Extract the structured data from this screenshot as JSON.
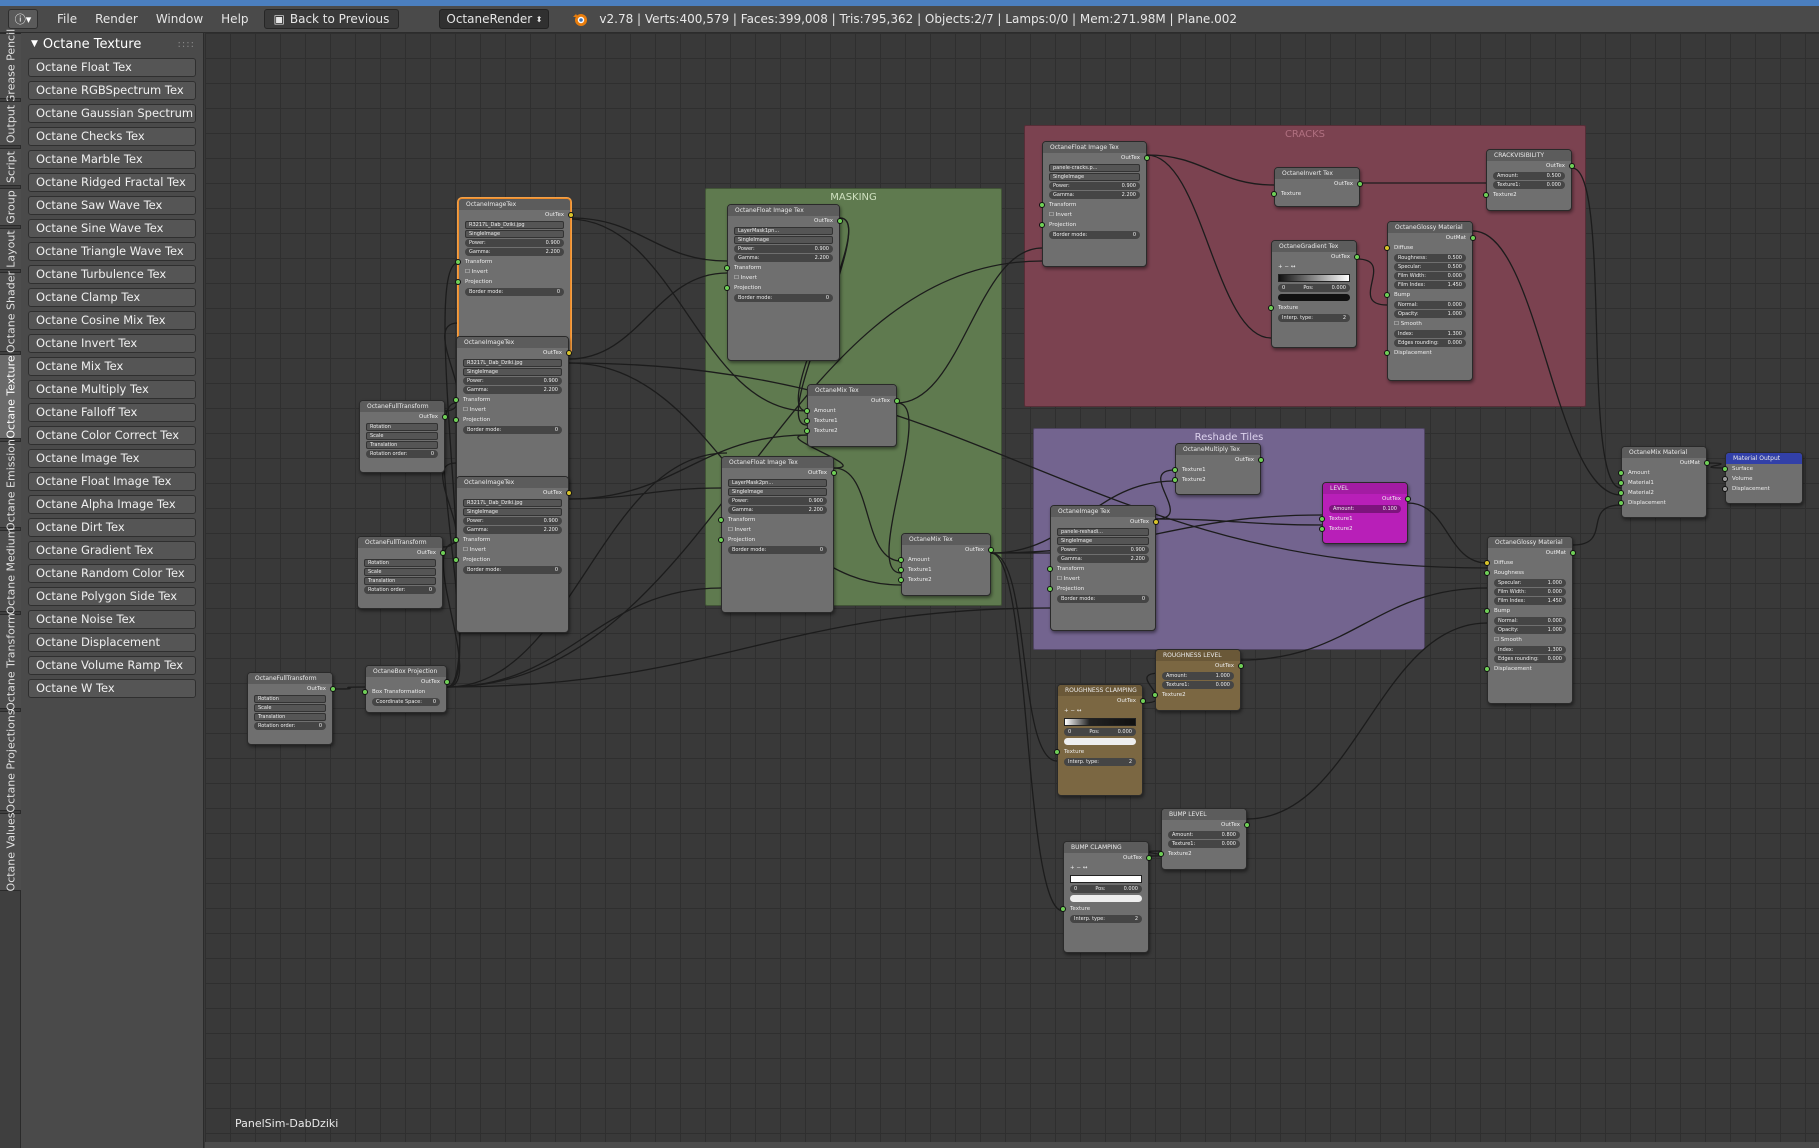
{
  "header": {
    "menus": [
      "File",
      "Render",
      "Window",
      "Help"
    ],
    "back_label": "Back to Previous",
    "render_engine": "OctaneRender",
    "stats": "v2.78 | Verts:400,579 | Faces:399,008 | Tris:795,362 | Objects:2/7 | Lamps:0/0 | Mem:271.98M | Plane.002"
  },
  "tabs": [
    "Grease Pencil",
    "Output",
    "Script",
    "Group",
    "Layout",
    "Octane Shader",
    "Octane Texture",
    "Octane Emission",
    "Octane Medium",
    "Octane Transform",
    "Octane Projections",
    "Octane Values"
  ],
  "panel": {
    "title": "Octane Texture",
    "items": [
      "Octane Float Tex",
      "Octane RGBSpectrum Tex",
      "Octane Gaussian Spectrum Tex",
      "Octane Checks Tex",
      "Octane Marble Tex",
      "Octane Ridged Fractal Tex",
      "Octane Saw Wave Tex",
      "Octane Sine Wave Tex",
      "Octane Triangle Wave Tex",
      "Octane Turbulence Tex",
      "Octane Clamp Tex",
      "Octane Cosine Mix Tex",
      "Octane Invert Tex",
      "Octane Mix Tex",
      "Octane Multiply Tex",
      "Octane Falloff Tex",
      "Octane Color Correct Tex",
      "Octane Image Tex",
      "Octane Float Image Tex",
      "Octane Alpha Image Tex",
      "Octane Dirt Tex",
      "Octane Gradient Tex",
      "Octane Random Color Tex",
      "Octane Polygon Side Tex",
      "Octane Noise Tex",
      "Octane Displacement",
      "Octane Volume Ramp Tex",
      "Octane W Tex"
    ]
  },
  "frames": {
    "masking": "MASKING",
    "cracks": "CRACKS",
    "reshade": "Reshade Tiles"
  },
  "canvas": {
    "scene_name": "PanelSim-DabDziki"
  },
  "colors": {
    "masking": "#5f7a4f",
    "cracks": "#7b4250",
    "reshade": "#73648f",
    "level": "#b81fb8",
    "output": "#3240a8",
    "selected": "#f08c28"
  },
  "nodes": {
    "img1": {
      "title": "OctaneImageTex",
      "out": "OutTex",
      "file": "R3217L_Dab_Dziki.jpg",
      "mode": "SingleImage",
      "power": "Power:",
      "power_v": "0.900",
      "gamma": "Gamma:",
      "gamma_v": "2.200",
      "transform": "Transform",
      "invert": "Invert",
      "projection": "Projection",
      "border": "Border mode:",
      "border_v": "0"
    },
    "img2": {
      "title": "OctaneImageTex",
      "out": "OutTex",
      "file": "R3217L_Dab_Dziki.jpg",
      "mode": "SingleImage",
      "power": "Power:",
      "power_v": "0.900",
      "gamma": "Gamma:",
      "gamma_v": "2.200",
      "transform": "Transform",
      "invert": "Invert",
      "projection": "Projection",
      "border": "Border mode:",
      "border_v": "0"
    },
    "img3": {
      "title": "OctaneImageTex",
      "out": "OutTex",
      "file": "R3217L_Dab_Dziki.jpg",
      "mode": "SingleImage",
      "power": "Power:",
      "power_v": "0.900",
      "gamma": "Gamma:",
      "gamma_v": "2.200",
      "transform": "Transform",
      "invert": "Invert",
      "projection": "Projection",
      "border": "Border mode:",
      "border_v": "0"
    },
    "ft1": {
      "title": "OctaneFullTransform",
      "out": "OutTex",
      "rot": "Rotation",
      "scale": "Scale",
      "trans": "Translation",
      "order": "Rotation order:",
      "order_v": "0"
    },
    "ft2": {
      "title": "OctaneFullTransform",
      "out": "OutTex",
      "rot": "Rotation",
      "scale": "Scale",
      "trans": "Translation",
      "order": "Rotation order:",
      "order_v": "0"
    },
    "ft3": {
      "title": "OctaneFullTransform",
      "out": "OutTex",
      "rot": "Rotation",
      "scale": "Scale",
      "trans": "Translation",
      "order": "Rotation order:",
      "order_v": "0"
    },
    "boxproj": {
      "title": "OctaneBox Projection",
      "out": "OutTex",
      "bt": "Box Transformation",
      "cs": "Coordinate Space:",
      "cs_v": "0"
    },
    "fimg1": {
      "title": "OctaneFloat Image Tex",
      "out": "OutTex",
      "file": "LayerMask1pn...",
      "mode": "SingleImage",
      "power": "Power:",
      "power_v": "0.900",
      "gamma": "Gamma:",
      "gamma_v": "2.200",
      "transform": "Transform",
      "invert": "Invert",
      "projection": "Projection",
      "border": "Border mode:",
      "border_v": "0"
    },
    "fimg2": {
      "title": "OctaneFloat Image Tex",
      "out": "OutTex",
      "file": "LayerMask2pn...",
      "mode": "SingleImage",
      "power": "Power:",
      "power_v": "0.900",
      "gamma": "Gamma:",
      "gamma_v": "2.200",
      "transform": "Transform",
      "invert": "Invert",
      "projection": "Projection",
      "border": "Border mode:",
      "border_v": "0"
    },
    "mix1": {
      "title": "OctaneMix Tex",
      "out": "OutTex",
      "amount": "Amount",
      "t1": "Texture1",
      "t2": "Texture2"
    },
    "mix2": {
      "title": "OctaneMix Tex",
      "out": "OutTex",
      "amount": "Amount",
      "t1": "Texture1",
      "t2": "Texture2"
    },
    "crackimg": {
      "title": "OctaneFloat Image Tex",
      "out": "OutTex",
      "file": "panele-cracks.p...",
      "mode": "SingleImage",
      "power": "Power:",
      "power_v": "0.900",
      "gamma": "Gamma:",
      "gamma_v": "2.200",
      "transform": "Transform",
      "invert": "Invert",
      "projection": "Projection",
      "border": "Border mode:",
      "border_v": "0"
    },
    "invert": {
      "title": "OctaneInvert Tex",
      "out": "OutTex",
      "tex": "Texture"
    },
    "gradient": {
      "title": "OctaneGradient Tex",
      "out": "OutTex",
      "ramp_btns": "+ − ↔",
      "idx": "0",
      "pos": "Pos:",
      "pos_v": "0.000",
      "tex": "Texture",
      "interp": "Interp. type:",
      "interp_v": "2"
    },
    "crackvis": {
      "title": "CRACKVISIBILITY",
      "out": "OutTex",
      "amount": "Amount:",
      "amount_v": "0.500",
      "t1": "Texture1:",
      "t1_v": "0.000",
      "t2": "Texture2"
    },
    "glossy1": {
      "title": "OctaneGlossy Material",
      "out": "OutMat",
      "diffuse": "Diffuse",
      "rough": "Roughness:",
      "rough_v": "0.500",
      "spec": "Specular:",
      "spec_v": "0.500",
      "fw": "Film Width:",
      "fw_v": "0.000",
      "fi": "Film Index:",
      "fi_v": "1.450",
      "bump": "Bump",
      "normal": "Normal:",
      "normal_v": "0.000",
      "opacity": "Opacity:",
      "opacity_v": "1.000",
      "smooth": "Smooth",
      "index": "Index:",
      "index_v": "1.300",
      "edges": "Edges rounding:",
      "edges_v": "0.000",
      "disp": "Displacement"
    },
    "multiply": {
      "title": "OctaneMultiply Tex",
      "out": "OutTex",
      "t1": "Texture1",
      "t2": "Texture2"
    },
    "reshadeimg": {
      "title": "OctaneImage Tex",
      "out": "OutTex",
      "file": "panele-reshadi...",
      "mode": "SingleImage",
      "power": "Power:",
      "power_v": "0.900",
      "gamma": "Gamma:",
      "gamma_v": "2.200",
      "transform": "Transform",
      "invert": "Invert",
      "projection": "Projection",
      "border": "Border mode:",
      "border_v": "0"
    },
    "level": {
      "title": "LEVEL",
      "out": "OutTex",
      "amount": "Amount:",
      "amount_v": "0.100",
      "t1": "Texture1",
      "t2": "Texture2"
    },
    "mixmat": {
      "title": "OctaneMix Material",
      "out": "OutMat",
      "amount": "Amount",
      "m1": "Material1",
      "m2": "Material2",
      "disp": "Displacement"
    },
    "matout": {
      "title": "Material Output",
      "surface": "Surface",
      "volume": "Volume",
      "disp": "Displacement"
    },
    "glossy2": {
      "title": "OctaneGlossy Material",
      "out": "OutMat",
      "diffuse": "Diffuse",
      "rough": "Roughness",
      "spec": "Specular:",
      "spec_v": "1.000",
      "fw": "Film Width:",
      "fw_v": "0.000",
      "fi": "Film Index:",
      "fi_v": "1.450",
      "bump": "Bump",
      "normal": "Normal:",
      "normal_v": "0.000",
      "opacity": "Opacity:",
      "opacity_v": "1.000",
      "smooth": "Smooth",
      "index": "Index:",
      "index_v": "1.300",
      "edges": "Edges rounding:",
      "edges_v": "0.000",
      "disp": "Displacement"
    },
    "roughlevel": {
      "title": "ROUGHNESS LEVEL",
      "out": "OutTex",
      "amount": "Amount:",
      "amount_v": "1.000",
      "t1": "Texture1:",
      "t1_v": "0.000",
      "t2": "Texture2"
    },
    "roughclamp": {
      "title": "ROUGHNESS CLAMPING",
      "out": "OutTex",
      "ramp_btns": "+ − ↔",
      "idx": "0",
      "pos": "Pos:",
      "pos_v": "0.000",
      "tex": "Texture",
      "interp": "Interp. type:",
      "interp_v": "2"
    },
    "bumplevel": {
      "title": "BUMP LEVEL",
      "out": "OutTex",
      "amount": "Amount:",
      "amount_v": "0.800",
      "t1": "Texture1:",
      "t1_v": "0.000",
      "t2": "Texture2"
    },
    "bumpclamp": {
      "title": "BUMP CLAMPING",
      "out": "OutTex",
      "ramp_btns": "+ − ↔",
      "idx": "0",
      "pos": "Pos:",
      "pos_v": "0.000",
      "tex": "Texture",
      "interp": "Interp. type:",
      "interp_v": "2"
    }
  }
}
